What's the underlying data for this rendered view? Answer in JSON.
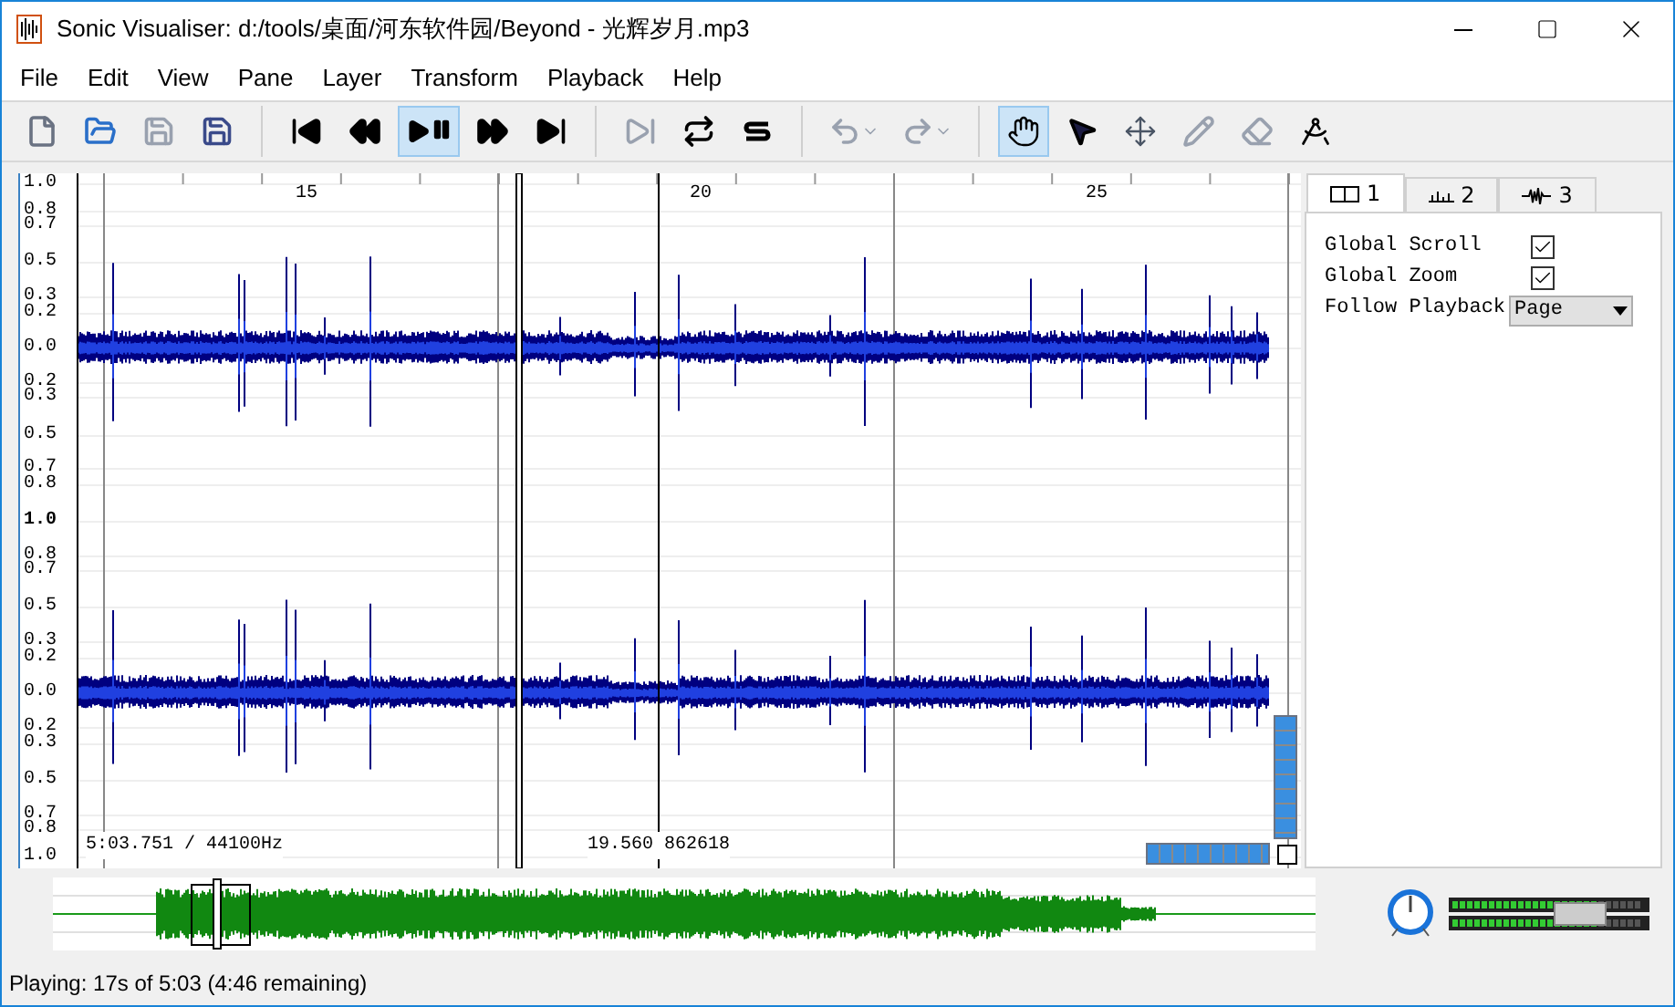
{
  "window": {
    "title": "Sonic Visualiser: d:/tools/桌面/河东软件园/Beyond - 光辉岁月.mp3"
  },
  "menu": [
    "File",
    "Edit",
    "View",
    "Pane",
    "Layer",
    "Transform",
    "Playback",
    "Help"
  ],
  "toolbar": [
    [
      {
        "kind": "new",
        "selected": false
      },
      {
        "kind": "open",
        "selected": false
      },
      {
        "kind": "save",
        "selected": false
      },
      {
        "kind": "save-as",
        "selected": false
      }
    ],
    [
      {
        "kind": "start",
        "selected": false
      },
      {
        "kind": "rewind",
        "selected": false
      },
      {
        "kind": "play",
        "selected": true
      },
      {
        "kind": "ffwd",
        "selected": false
      },
      {
        "kind": "end",
        "selected": false
      }
    ],
    [
      {
        "kind": "constrain",
        "selected": false
      },
      {
        "kind": "loop",
        "selected": false
      },
      {
        "kind": "solo",
        "selected": false
      }
    ],
    [
      {
        "kind": "undo",
        "selected": false
      },
      {
        "kind": "redo",
        "selected": false
      }
    ],
    [
      {
        "kind": "navigate",
        "selected": true
      },
      {
        "kind": "select",
        "selected": false
      },
      {
        "kind": "move",
        "selected": false
      },
      {
        "kind": "draw",
        "selected": false
      },
      {
        "kind": "erase",
        "selected": false
      },
      {
        "kind": "measure",
        "selected": false
      }
    ]
  ],
  "vertical_zoom": {
    "level": 1.0
  },
  "horizontal_zoom": {
    "level": 1.0
  },
  "ruler": {
    "time_labels": [
      "15",
      "20",
      "25"
    ]
  },
  "scale_labels": [
    "1.0",
    "0.8",
    "0.7",
    "0.5",
    "0.3",
    "0.2",
    "0.0",
    "0.2",
    "0.3",
    "0.5",
    "0.7",
    "0.8",
    "1.0",
    "0.8",
    "0.7",
    "0.5",
    "0.3",
    "0.2",
    "0.0",
    "0.2",
    "0.3",
    "0.5",
    "0.7",
    "0.8",
    "1.0"
  ],
  "pane": {
    "position": "5:03.751 / 44100Hz",
    "cursor": "19.560 862618"
  },
  "tabs": [
    {
      "kind": "pane",
      "label": "1",
      "selected": true
    },
    {
      "kind": "bars",
      "label": "2",
      "selected": false
    },
    {
      "kind": "wave",
      "label": "3",
      "selected": false
    }
  ],
  "properties": [
    {
      "kind": "checkbox",
      "label": "Global Scroll",
      "checked": true
    },
    {
      "kind": "checkbox",
      "label": "Global Zoom",
      "checked": true
    },
    {
      "kind": "select",
      "label": "Follow Playback",
      "value": "Page"
    }
  ],
  "status_bar": {
    "text": "Playing: 17s of 5:03 (4:46 remaining)"
  }
}
